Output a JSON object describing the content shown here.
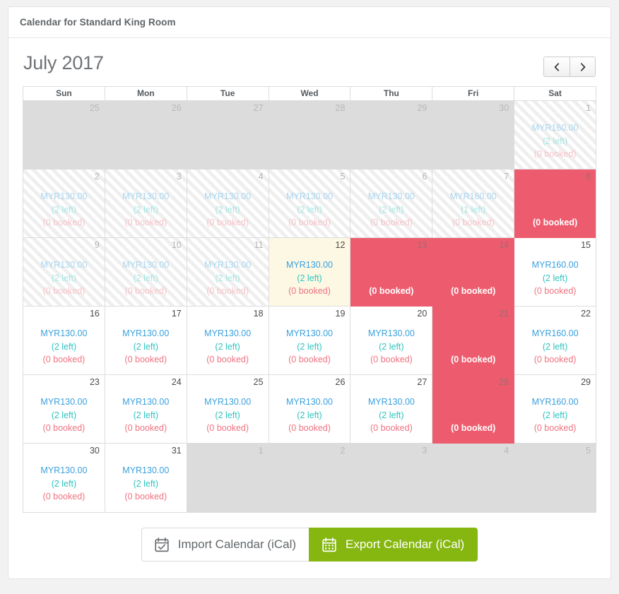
{
  "panel": {
    "title": "Calendar for Standard King Room"
  },
  "calendar": {
    "month_label": "July 2017",
    "prev_label": "‹",
    "next_label": "›",
    "weekday_headers": [
      "Sun",
      "Mon",
      "Tue",
      "Wed",
      "Thu",
      "Fri",
      "Sat"
    ],
    "colors": {
      "price": "#3aa0dd",
      "left": "#2fc4c0",
      "booked": "#ef7381",
      "full_background": "#ed5c6e",
      "today_background": "#fcf8e3",
      "outside_background": "#dcdcdc",
      "export_button": "#86b710"
    },
    "weeks": [
      [
        {
          "day": "25",
          "state": "out",
          "price": "",
          "left": "",
          "booked": ""
        },
        {
          "day": "26",
          "state": "out",
          "price": "",
          "left": "",
          "booked": ""
        },
        {
          "day": "27",
          "state": "out",
          "price": "",
          "left": "",
          "booked": ""
        },
        {
          "day": "28",
          "state": "out",
          "price": "",
          "left": "",
          "booked": ""
        },
        {
          "day": "29",
          "state": "out",
          "price": "",
          "left": "",
          "booked": ""
        },
        {
          "day": "30",
          "state": "out",
          "price": "",
          "left": "",
          "booked": ""
        },
        {
          "day": "1",
          "state": "past",
          "price": "MYR160.00",
          "left": "(2 left)",
          "booked": "(0 booked)"
        }
      ],
      [
        {
          "day": "2",
          "state": "past",
          "price": "MYR130.00",
          "left": "(2 left)",
          "booked": "(0 booked)"
        },
        {
          "day": "3",
          "state": "past",
          "price": "MYR130.00",
          "left": "(2 left)",
          "booked": "(0 booked)"
        },
        {
          "day": "4",
          "state": "past",
          "price": "MYR130.00",
          "left": "(2 left)",
          "booked": "(0 booked)"
        },
        {
          "day": "5",
          "state": "past",
          "price": "MYR130.00",
          "left": "(2 left)",
          "booked": "(0 booked)"
        },
        {
          "day": "6",
          "state": "past",
          "price": "MYR130.00",
          "left": "(2 left)",
          "booked": "(0 booked)"
        },
        {
          "day": "7",
          "state": "past",
          "price": "MYR160.00",
          "left": "(1 left)",
          "booked": "(0 booked)"
        },
        {
          "day": "8",
          "state": "full",
          "price": "",
          "left": "",
          "booked": "(0 booked)"
        }
      ],
      [
        {
          "day": "9",
          "state": "past",
          "price": "MYR130.00",
          "left": "(2 left)",
          "booked": "(0 booked)"
        },
        {
          "day": "10",
          "state": "past",
          "price": "MYR130.00",
          "left": "(2 left)",
          "booked": "(0 booked)"
        },
        {
          "day": "11",
          "state": "past",
          "price": "MYR130.00",
          "left": "(2 left)",
          "booked": "(0 booked)"
        },
        {
          "day": "12",
          "state": "today",
          "price": "MYR130.00",
          "left": "(2 left)",
          "booked": "(0 booked)"
        },
        {
          "day": "13",
          "state": "full",
          "price": "",
          "left": "",
          "booked": "(0 booked)"
        },
        {
          "day": "14",
          "state": "full",
          "price": "",
          "left": "",
          "booked": "(0 booked)"
        },
        {
          "day": "15",
          "state": "open",
          "price": "MYR160.00",
          "left": "(2 left)",
          "booked": "(0 booked)"
        }
      ],
      [
        {
          "day": "16",
          "state": "open",
          "price": "MYR130.00",
          "left": "(2 left)",
          "booked": "(0 booked)"
        },
        {
          "day": "17",
          "state": "open",
          "price": "MYR130.00",
          "left": "(2 left)",
          "booked": "(0 booked)"
        },
        {
          "day": "18",
          "state": "open",
          "price": "MYR130.00",
          "left": "(2 left)",
          "booked": "(0 booked)"
        },
        {
          "day": "19",
          "state": "open",
          "price": "MYR130.00",
          "left": "(2 left)",
          "booked": "(0 booked)"
        },
        {
          "day": "20",
          "state": "open",
          "price": "MYR130.00",
          "left": "(2 left)",
          "booked": "(0 booked)"
        },
        {
          "day": "21",
          "state": "full",
          "price": "",
          "left": "",
          "booked": "(0 booked)"
        },
        {
          "day": "22",
          "state": "open",
          "price": "MYR160.00",
          "left": "(2 left)",
          "booked": "(0 booked)"
        }
      ],
      [
        {
          "day": "23",
          "state": "open",
          "price": "MYR130.00",
          "left": "(2 left)",
          "booked": "(0 booked)"
        },
        {
          "day": "24",
          "state": "open",
          "price": "MYR130.00",
          "left": "(2 left)",
          "booked": "(0 booked)"
        },
        {
          "day": "25",
          "state": "open",
          "price": "MYR130.00",
          "left": "(2 left)",
          "booked": "(0 booked)"
        },
        {
          "day": "26",
          "state": "open",
          "price": "MYR130.00",
          "left": "(2 left)",
          "booked": "(0 booked)"
        },
        {
          "day": "27",
          "state": "open",
          "price": "MYR130.00",
          "left": "(2 left)",
          "booked": "(0 booked)"
        },
        {
          "day": "28",
          "state": "full",
          "price": "",
          "left": "",
          "booked": "(0 booked)"
        },
        {
          "day": "29",
          "state": "open",
          "price": "MYR160.00",
          "left": "(2 left)",
          "booked": "(0 booked)"
        }
      ],
      [
        {
          "day": "30",
          "state": "open",
          "price": "MYR130.00",
          "left": "(2 left)",
          "booked": "(0 booked)"
        },
        {
          "day": "31",
          "state": "open",
          "price": "MYR130.00",
          "left": "(2 left)",
          "booked": "(0 booked)"
        },
        {
          "day": "1",
          "state": "out",
          "price": "",
          "left": "",
          "booked": ""
        },
        {
          "day": "2",
          "state": "out",
          "price": "",
          "left": "",
          "booked": ""
        },
        {
          "day": "3",
          "state": "out",
          "price": "",
          "left": "",
          "booked": ""
        },
        {
          "day": "4",
          "state": "out",
          "price": "",
          "left": "",
          "booked": ""
        },
        {
          "day": "5",
          "state": "out",
          "price": "",
          "left": "",
          "booked": ""
        }
      ]
    ]
  },
  "footer": {
    "import_label": "Import Calendar (iCal)",
    "export_label": "Export Calendar (iCal)"
  }
}
